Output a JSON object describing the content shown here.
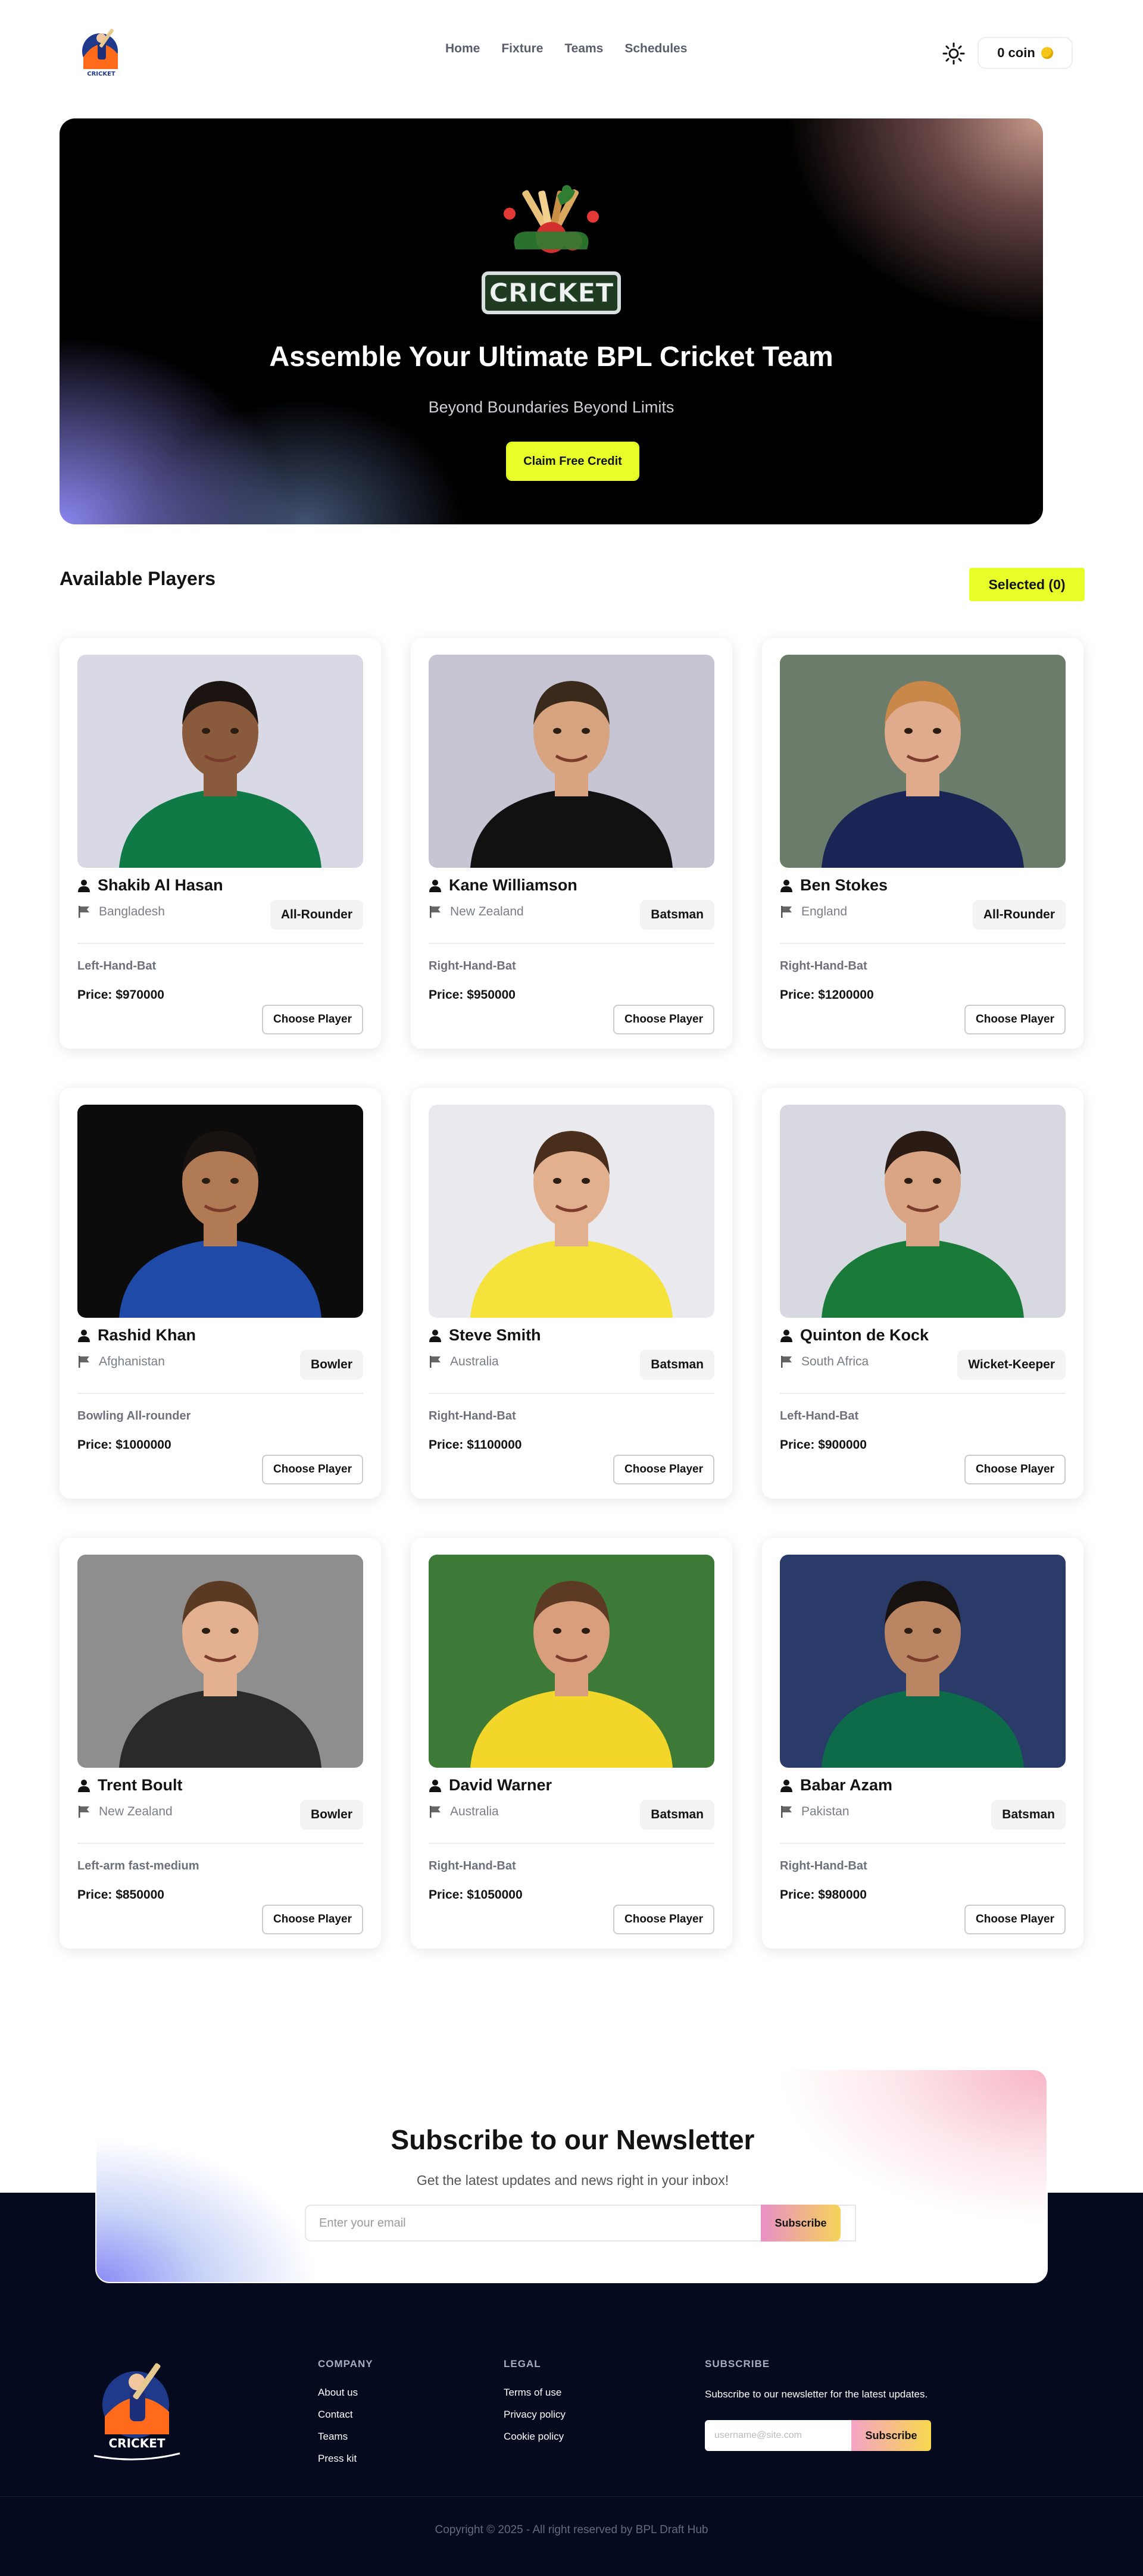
{
  "nav": {
    "links": [
      "Home",
      "Fixture",
      "Teams",
      "Schedules"
    ],
    "coin_label": "0 coin",
    "logo_text": "CRICKET"
  },
  "hero": {
    "banner_text": "CRICKET",
    "title": "Assemble Your Ultimate BPL Cricket Team",
    "subtitle": "Beyond Boundaries Beyond Limits",
    "cta_label": "Claim Free Credit"
  },
  "players_section": {
    "title": "Available Players",
    "selected_label": "Selected (0)",
    "choose_label": "Choose Player"
  },
  "players": [
    {
      "name": "Shakib Al Hasan",
      "country": "Bangladesh",
      "role": "All-Rounder",
      "style": "Left-Hand-Bat",
      "price": "Price: $970000",
      "jersey": "#0f7a45",
      "bg": "#d9d9e6",
      "skin": "#8a5a3c",
      "hair": "#1b1410"
    },
    {
      "name": "Kane Williamson",
      "country": "New Zealand",
      "role": "Batsman",
      "style": "Right-Hand-Bat",
      "price": "Price: $950000",
      "jersey": "#111111",
      "bg": "#c7c4d3",
      "skin": "#d7a47f",
      "hair": "#3a2a1c"
    },
    {
      "name": "Ben Stokes",
      "country": "England",
      "role": "All-Rounder",
      "style": "Right-Hand-Bat",
      "price": "Price: $1200000",
      "jersey": "#1a2455",
      "bg": "#6b7d6a",
      "skin": "#e0ab8c",
      "hair": "#c9874a"
    },
    {
      "name": "Rashid Khan",
      "country": "Afghanistan",
      "role": "Bowler",
      "style": "Bowling All-rounder",
      "price": "Price: $1000000",
      "jersey": "#1f4aa8",
      "bg": "#0c0c0d",
      "skin": "#b07a55",
      "hair": "#181210"
    },
    {
      "name": "Steve Smith",
      "country": "Australia",
      "role": "Batsman",
      "style": "Right-Hand-Bat",
      "price": "Price: $1100000",
      "jersey": "#f5e23a",
      "bg": "#e9e9ee",
      "skin": "#e2b08e",
      "hair": "#4a2e1c"
    },
    {
      "name": "Quinton de Kock",
      "country": "South Africa",
      "role": "Wicket-Keeper",
      "style": "Left-Hand-Bat",
      "price": "Price: $900000",
      "jersey": "#1a7a3a",
      "bg": "#d8d8e0",
      "skin": "#d9a584",
      "hair": "#2a1c14"
    },
    {
      "name": "Trent Boult",
      "country": "New Zealand",
      "role": "Bowler",
      "style": "Left-arm fast-medium",
      "price": "Price: $850000",
      "jersey": "#2a2a2a",
      "bg": "#8e8e8e",
      "skin": "#e3b18f",
      "hair": "#5a3a22"
    },
    {
      "name": "David Warner",
      "country": "Australia",
      "role": "Batsman",
      "style": "Right-Hand-Bat",
      "price": "Price: $1050000",
      "jersey": "#f2d62a",
      "bg": "#3d7a37",
      "skin": "#d99f7c",
      "hair": "#5c3a24"
    },
    {
      "name": "Babar Azam",
      "country": "Pakistan",
      "role": "Batsman",
      "style": "Right-Hand-Bat",
      "price": "Price: $980000",
      "jersey": "#0e6b4a",
      "bg": "#2a3b6a",
      "skin": "#b98563",
      "hair": "#171110"
    }
  ],
  "newsletter": {
    "title": "Subscribe to our Newsletter",
    "subtitle": "Get the latest updates and news right in your inbox!",
    "placeholder": "Enter your email",
    "button": "Subscribe"
  },
  "footer": {
    "logo_text": "CRICKET",
    "company": {
      "heading": "COMPANY",
      "links": [
        "About us",
        "Contact",
        "Teams",
        "Press kit"
      ]
    },
    "legal": {
      "heading": "LEGAL",
      "links": [
        "Terms of use",
        "Privacy policy",
        "Cookie policy"
      ]
    },
    "subscribe": {
      "heading": "SUBSCRIBE",
      "text": "Subscribe to our newsletter for the latest updates.",
      "placeholder": "username@site.com",
      "button": "Subscribe"
    },
    "copyright": "Copyright © 2025 - All right reserved by BPL Draft Hub"
  },
  "colors": {
    "accent": "#e7fe29",
    "footer_bg": "#060a1f",
    "coin": "#f5c518"
  }
}
